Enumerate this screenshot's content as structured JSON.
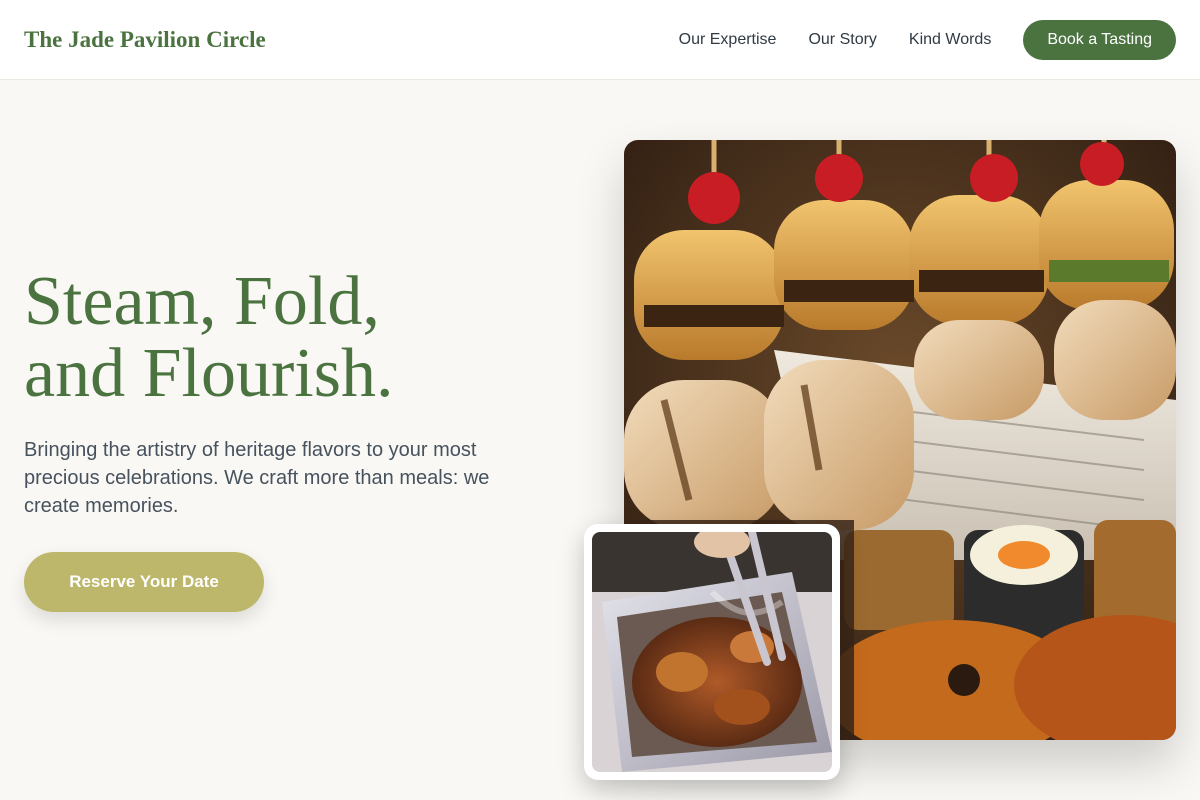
{
  "header": {
    "brand": "The Jade Pavilion Circle",
    "nav": [
      "Our Expertise",
      "Our Story",
      "Kind Words"
    ],
    "cta": "Book a Tasting"
  },
  "hero": {
    "title_line1": "Steam, Fold,",
    "title_line2": "and Flourish.",
    "subtitle": "Bringing the artistry of heritage flavors to your most precious celebrations. We craft more than meals: we create memories.",
    "button": "Reserve Your Date"
  },
  "colors": {
    "brand_green": "#4a7340",
    "accent_olive": "#bdb76b",
    "background": "#faf8f4"
  }
}
